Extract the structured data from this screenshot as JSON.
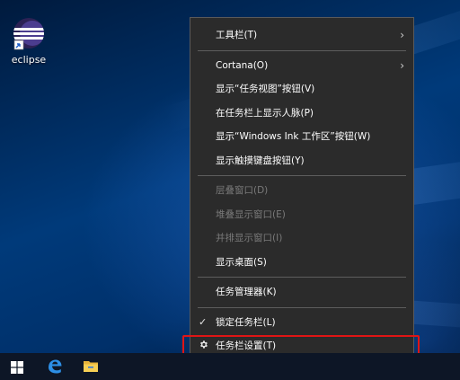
{
  "desktop": {
    "icons": [
      {
        "label": "eclipse",
        "icon": "eclipse-icon"
      }
    ]
  },
  "context_menu": {
    "items": [
      {
        "label": "工具栏(T)",
        "submenu": true,
        "enabled": true
      },
      {
        "separator": true
      },
      {
        "label": "Cortana(O)",
        "submenu": true,
        "enabled": true
      },
      {
        "label": "显示“任务视图”按钮(V)",
        "enabled": true
      },
      {
        "label": "在任务栏上显示人脉(P)",
        "enabled": true
      },
      {
        "label": "显示“Windows Ink 工作区”按钮(W)",
        "enabled": true
      },
      {
        "label": "显示触摸键盘按钮(Y)",
        "enabled": true
      },
      {
        "separator": true
      },
      {
        "label": "层叠窗口(D)",
        "enabled": false
      },
      {
        "label": "堆叠显示窗口(E)",
        "enabled": false
      },
      {
        "label": "并排显示窗口(I)",
        "enabled": false
      },
      {
        "label": "显示桌面(S)",
        "enabled": true
      },
      {
        "separator": true
      },
      {
        "label": "任务管理器(K)",
        "enabled": true
      },
      {
        "separator": true
      },
      {
        "label": "锁定任务栏(L)",
        "enabled": true,
        "checked": true,
        "lead_icon": "checkmark-icon"
      },
      {
        "label": "任务栏设置(T)",
        "enabled": true,
        "lead_icon": "gear-icon",
        "highlighted": true
      }
    ],
    "highlight_color": "#e01515"
  },
  "taskbar": {
    "buttons": [
      {
        "icon": "windows-start-icon"
      },
      {
        "icon": "edge-browser-icon"
      },
      {
        "icon": "file-explorer-icon"
      }
    ],
    "background": "#0d1626"
  }
}
